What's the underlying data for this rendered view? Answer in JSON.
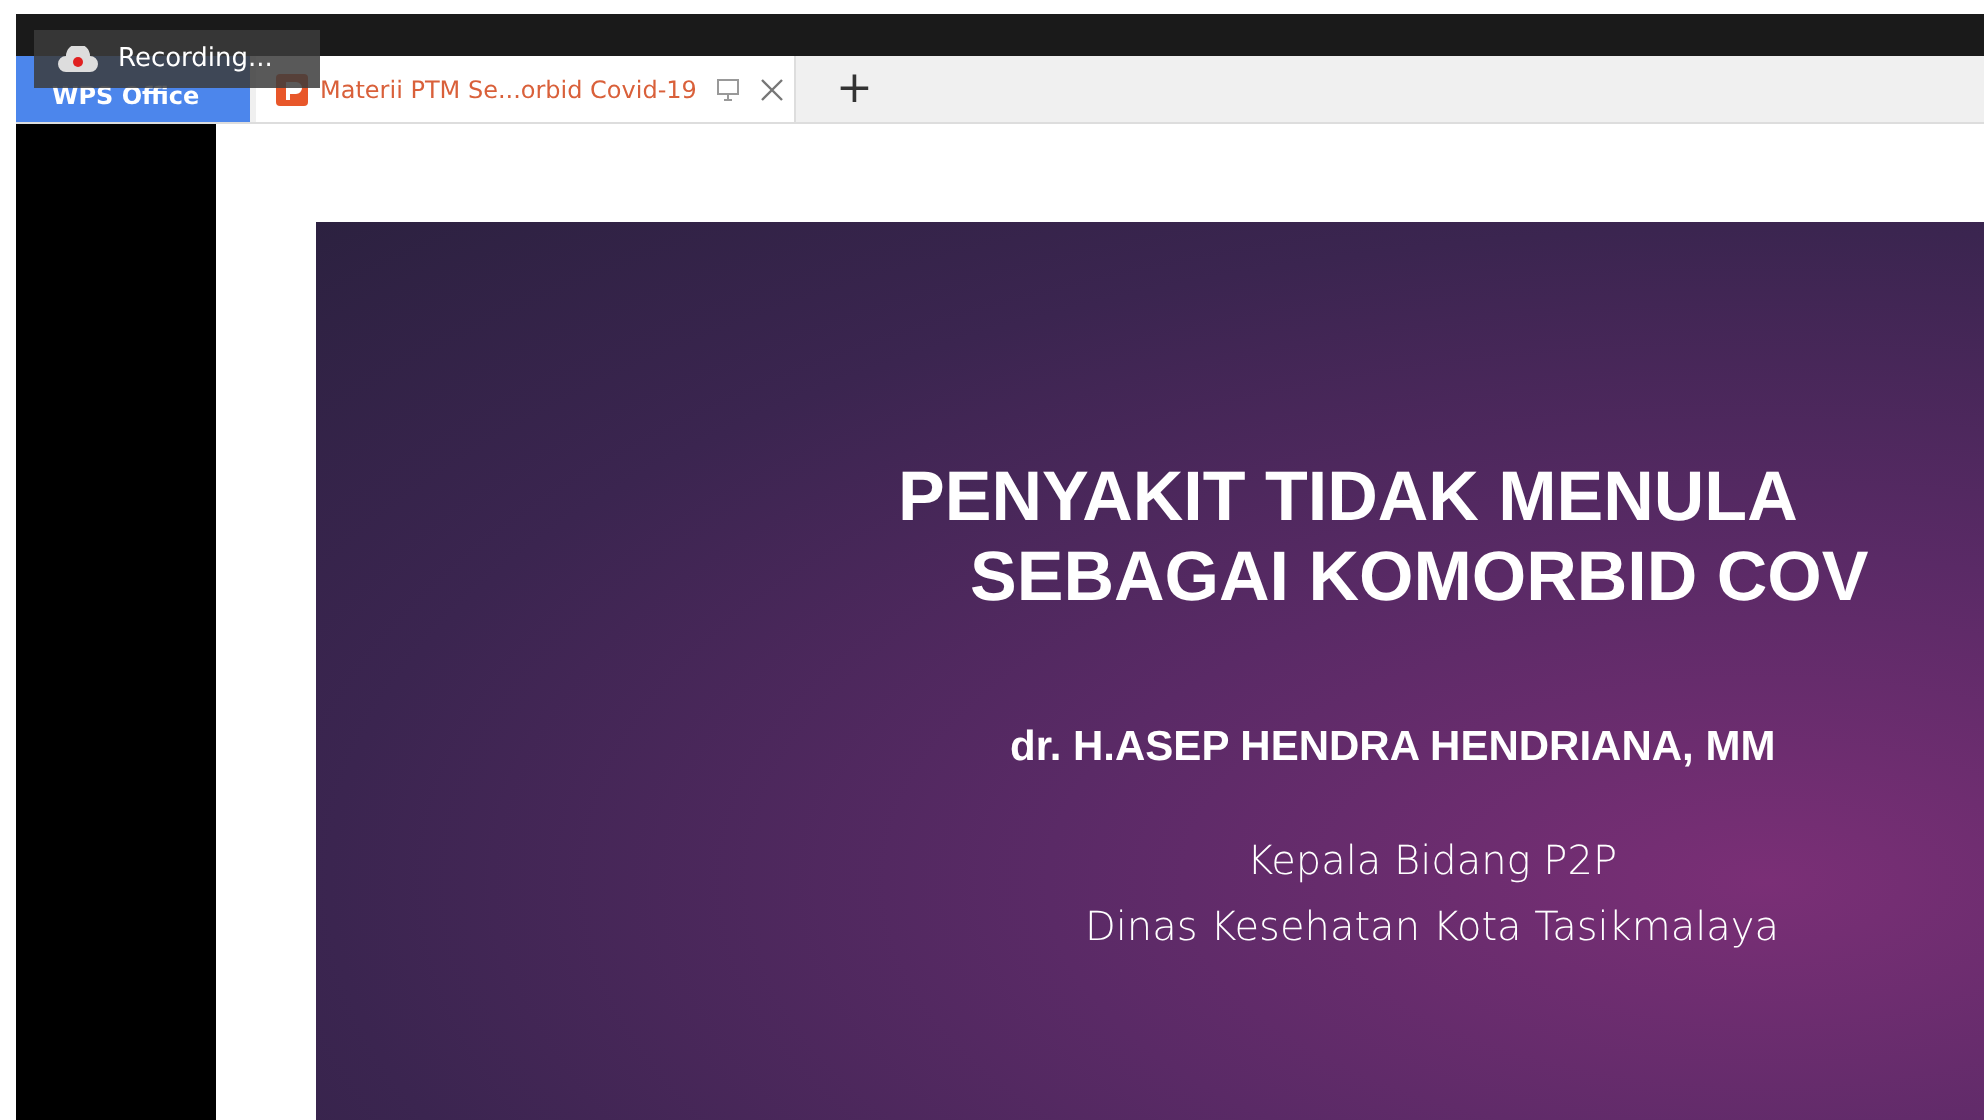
{
  "recording": {
    "label": "Recording..."
  },
  "tabs": [
    {
      "label": "WPS Office",
      "selected": false,
      "kind": "home"
    },
    {
      "label": "Materii PTM Se...orbid Covid-19",
      "selected": true,
      "kind": "document"
    }
  ],
  "new_tab": {
    "label": "+"
  },
  "slide": {
    "title_lines": [
      "PENYAKIT TIDAK MENULA",
      "SEBAGAI KOMORBID COV"
    ],
    "author": "dr. H.ASEP HENDRA HENDRIANA, MM",
    "position_lines": [
      "Kepala Bidang P2P",
      "Dinas Kesehatan Kota Tasikmalaya"
    ]
  }
}
